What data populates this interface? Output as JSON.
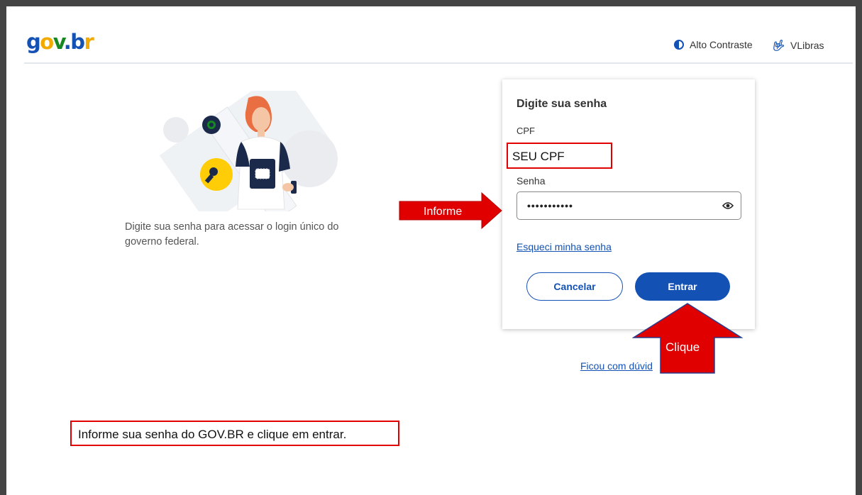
{
  "header": {
    "logo": {
      "g": "g",
      "o": "o",
      "v": "v",
      "dot": ".",
      "b": "b",
      "r": "r"
    },
    "contrast_label": "Alto Contraste",
    "vlibras_label": "VLibras"
  },
  "intro": {
    "text": "Digite sua senha para acessar o login único do governo federal."
  },
  "login": {
    "title": "Digite sua senha",
    "cpf_label": "CPF",
    "cpf_value": "SEU CPF",
    "password_label": "Senha",
    "password_value": "•••••••••••",
    "forgot_link": "Esqueci minha senha",
    "cancel_label": "Cancelar",
    "enter_label": "Entrar"
  },
  "help_link": "Ficou com dúvid",
  "annotations": {
    "informe_arrow": "Informe",
    "clique_arrow": "Clique",
    "instruction": "Informe sua senha do GOV.BR e clique em entrar.",
    "highlight_color": "#e00000"
  },
  "colors": {
    "brand_blue": "#1351b4",
    "brand_yellow": "#f2a900",
    "brand_green": "#168821"
  }
}
